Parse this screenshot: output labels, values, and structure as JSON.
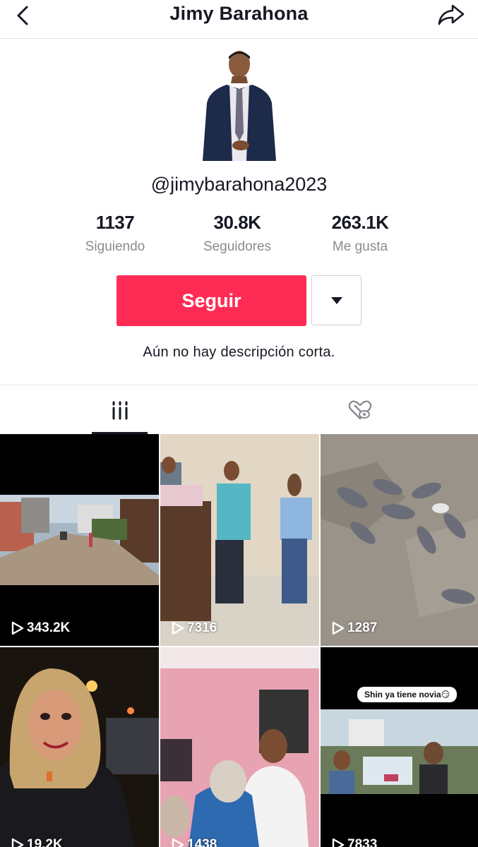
{
  "header": {
    "title": "Jimy Barahona",
    "back_icon": "chevron-left-icon",
    "share_icon": "share-arrow-icon"
  },
  "profile": {
    "handle": "@jimybarahona2023",
    "stats": [
      {
        "value": "1137",
        "label": "Siguiendo"
      },
      {
        "value": "30.8K",
        "label": "Seguidores"
      },
      {
        "value": "263.1K",
        "label": "Me gusta"
      }
    ],
    "follow_label": "Seguir",
    "bio": "Aún no hay descripción corta."
  },
  "tabs": [
    {
      "icon": "videos-grid-icon",
      "active": true
    },
    {
      "icon": "liked-hidden-icon",
      "active": false
    }
  ],
  "videos": [
    {
      "views": "343.2K"
    },
    {
      "views": "7316"
    },
    {
      "views": "1287"
    },
    {
      "views": "19.2K"
    },
    {
      "views": "1438"
    },
    {
      "views": "7833",
      "caption": "Shin ya tiene novia😏"
    }
  ],
  "colors": {
    "accent": "#fe2c55",
    "text": "#161823",
    "muted": "#8a8b91"
  }
}
